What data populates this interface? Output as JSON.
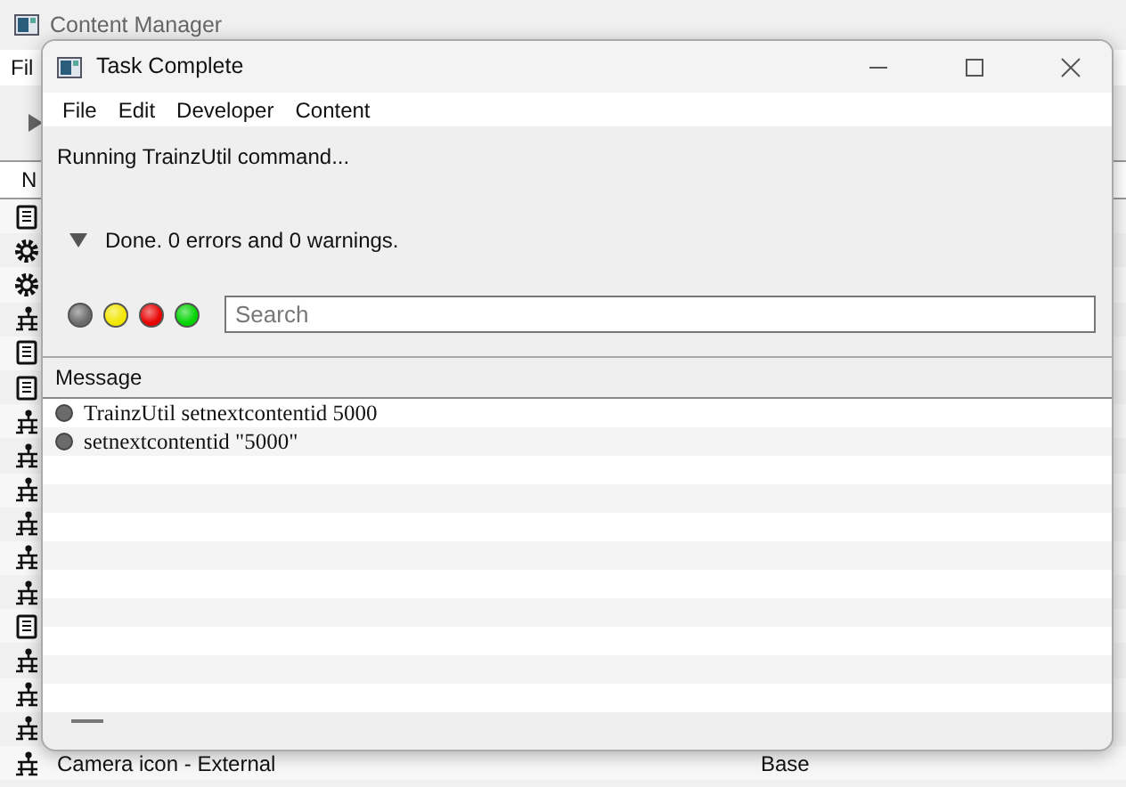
{
  "background_window": {
    "title": "Content Manager",
    "menu": [
      "Fil"
    ],
    "header": "N",
    "rows": [
      {
        "kind": "scroll"
      },
      {
        "kind": "gear"
      },
      {
        "kind": "gear"
      },
      {
        "kind": "network"
      },
      {
        "kind": "scroll"
      },
      {
        "kind": "scroll"
      },
      {
        "kind": "network"
      },
      {
        "kind": "network"
      },
      {
        "kind": "network"
      },
      {
        "kind": "network"
      },
      {
        "kind": "network"
      },
      {
        "kind": "network"
      },
      {
        "kind": "scroll"
      },
      {
        "kind": "network"
      },
      {
        "kind": "network"
      },
      {
        "kind": "network"
      }
    ],
    "last_row": {
      "kind": "network",
      "name": "Camera icon - External",
      "column_2": "Base"
    }
  },
  "dialog": {
    "title": "Task Complete",
    "menu": [
      "File",
      "Edit",
      "Developer",
      "Content"
    ],
    "status": "Running TrainzUtil command...",
    "summary": {
      "expanded": true,
      "text": "Done. 0 errors and 0 warnings."
    },
    "filters": [
      {
        "color": "#6b6b6b"
      },
      {
        "color": "#f2e600"
      },
      {
        "color": "#e80000"
      },
      {
        "color": "#00d400"
      }
    ],
    "search": {
      "placeholder": "Search"
    },
    "table": {
      "columns": [
        "Message"
      ],
      "rows": [
        {
          "color": "#6b6b6b",
          "message": "TrainzUtil setnextcontentid 5000"
        },
        {
          "color": "#6b6b6b",
          "message": "setnextcontentid \"5000\""
        }
      ]
    }
  }
}
